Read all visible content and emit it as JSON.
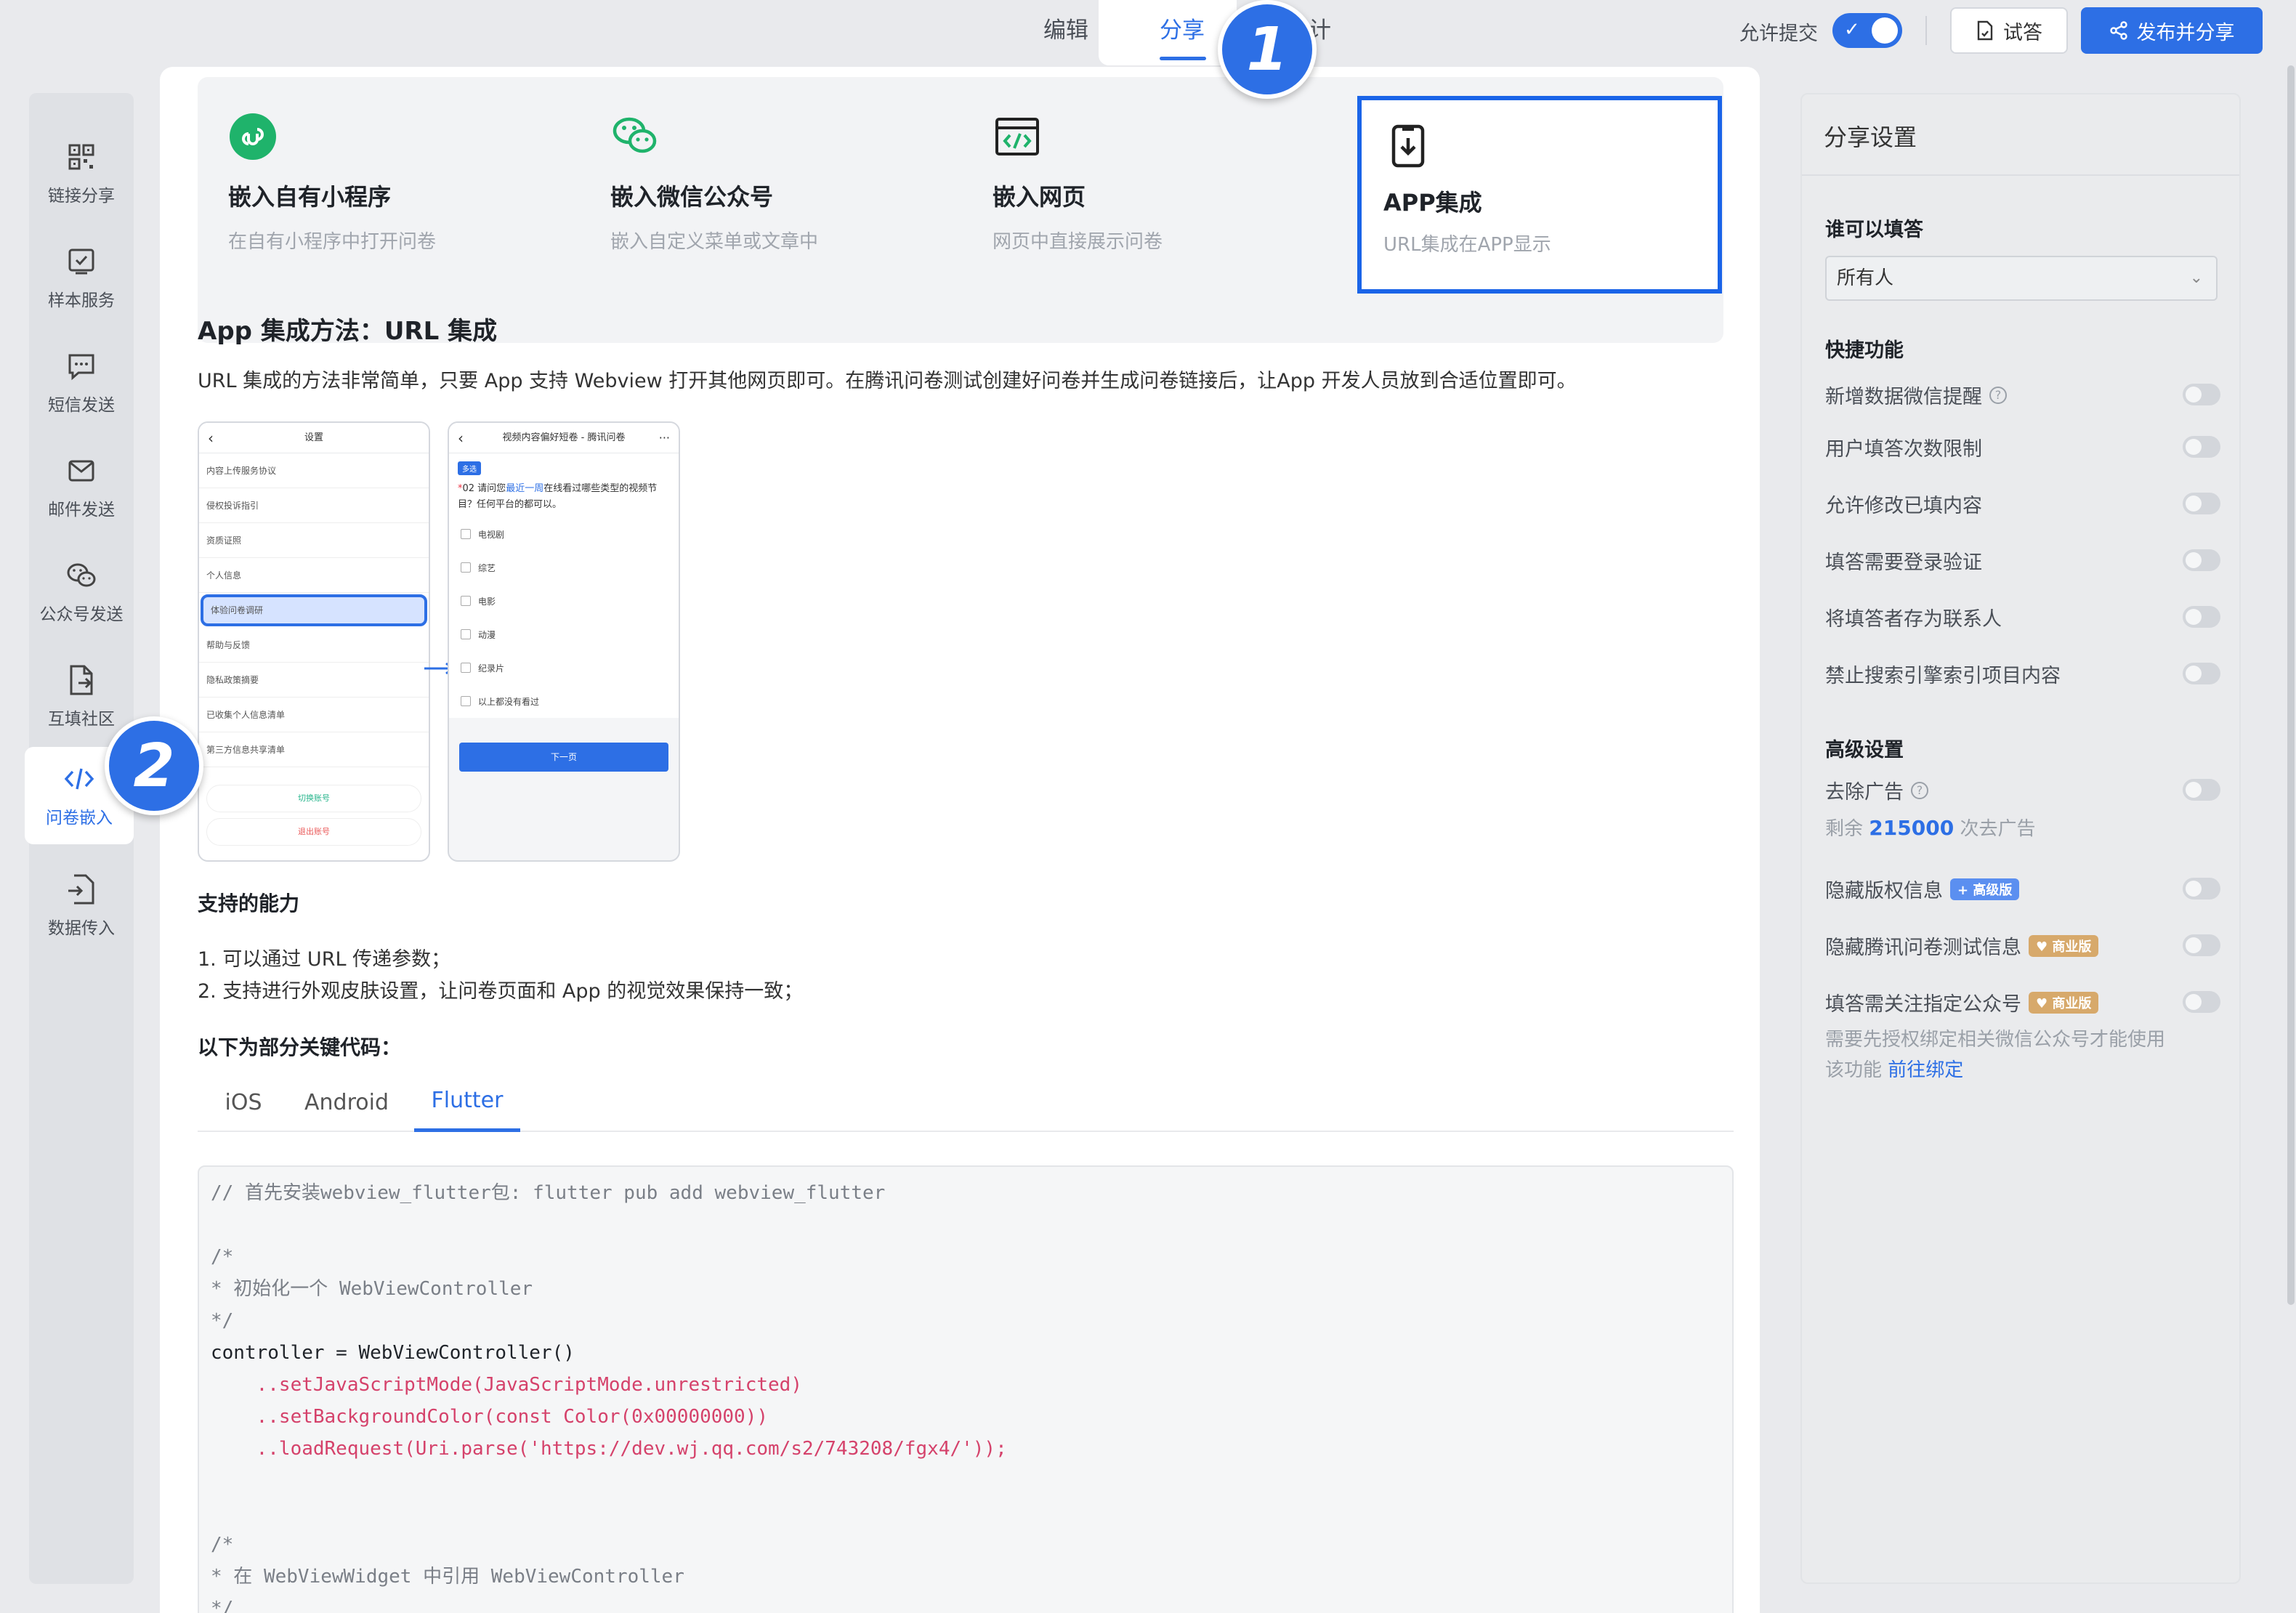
{
  "topbar": {
    "steps": [
      "编辑",
      "分享",
      "统计"
    ],
    "allow_label": "允许提交",
    "try_label": "试答",
    "publish_label": "发布并分享"
  },
  "badges": [
    "1",
    "2"
  ],
  "nav": [
    {
      "label": "链接分享",
      "icon": "qrcode-icon"
    },
    {
      "label": "样本服务",
      "icon": "checkbox-icon"
    },
    {
      "label": "短信发送",
      "icon": "message-icon"
    },
    {
      "label": "邮件发送",
      "icon": "mail-icon"
    },
    {
      "label": "公众号发送",
      "icon": "wechat-icon"
    },
    {
      "label": "互填社区",
      "icon": "document-icon"
    },
    {
      "label": "问卷嵌入",
      "icon": "code-icon"
    },
    {
      "label": "数据传入",
      "icon": "import-icon"
    }
  ],
  "cards": [
    {
      "title": "嵌入自有小程序",
      "desc": "在自有小程序中打开问卷",
      "icon": "miniprogram-icon"
    },
    {
      "title": "嵌入微信公众号",
      "desc": "嵌入自定义菜单或文章中",
      "icon": "wechat-icon"
    },
    {
      "title": "嵌入网页",
      "desc": "网页中直接展示问卷",
      "icon": "webpage-code-icon"
    },
    {
      "title": "APP集成",
      "desc": "URL集成在APP显示",
      "icon": "app-download-icon"
    }
  ],
  "main": {
    "section_title": "App 集成方法：URL 集成",
    "description": "URL 集成的方法非常简单，只要 App 支持 Webview 打开其他网页即可。在腾讯问卷测试创建好问卷并生成问卷链接后，让App 开发人员放到合适位置即可。",
    "capabilities_title": "支持的能力",
    "capabilities": [
      "1. 可以通过 URL 传递参数；",
      "2. 支持进行外观皮肤设置，让问卷页面和 App 的视觉效果保持一致；"
    ],
    "code_title": "以下为部分关键代码：",
    "tabs": [
      "iOS",
      "Android",
      "Flutter"
    ],
    "active_tab": "Flutter"
  },
  "mockup": {
    "settings_title": "设置",
    "settings_rows": [
      "内容上传服务协议",
      "侵权投诉指引",
      "资质证照",
      "个人信息",
      "体验问卷调研",
      "帮助与反馈",
      "隐私政策摘要",
      "已收集个人信息清单",
      "第三方信息共享清单"
    ],
    "switch_account": "切换账号",
    "logout": "退出账号",
    "survey_title": "视频内容偏好短卷 - 腾讯问卷",
    "survey_tag": "多选",
    "survey_q_prefix": "02 请问您",
    "survey_q_highlight": "最近一周",
    "survey_q_suffix": "在线看过哪些类型的视频节目？任何平台的都可以。",
    "survey_options": [
      "电视剧",
      "综艺",
      "电影",
      "动漫",
      "纪录片",
      "以上都没有看过"
    ],
    "next": "下一页"
  },
  "code_lines": [
    "// 首先安装webview_flutter包: flutter pub add webview_flutter",
    "",
    "/*",
    "* 初始化一个 WebViewController",
    "*/",
    "controller = WebViewController()",
    "    ..setJavaScriptMode(JavaScriptMode.unrestricted)",
    "    ..setBackgroundColor(const Color(0x00000000))",
    "    ..loadRequest(Uri.parse('https://dev.wj.qq.com/s2/743208/fgx4/'));",
    "",
    "",
    "/*",
    "* 在 WebViewWidget 中引用 WebViewController",
    "*/"
  ],
  "right": {
    "title": "分享设置",
    "who_title": "谁可以填答",
    "who_value": "所有人",
    "quick_title": "快捷功能",
    "quick_items": [
      "新增数据微信提醒",
      "用户填答次数限制",
      "允许修改已填内容",
      "填答需要登录验证",
      "将填答者存为联系人",
      "禁止搜索引擎索引项目内容"
    ],
    "advanced_title": "高级设置",
    "remove_ads": "去除广告",
    "remaining_prefix": "剩余",
    "remaining_count": "215000",
    "remaining_suffix": "次去广告",
    "hide_copyright": "隐藏版权信息",
    "badge_advanced": "+ 高级版",
    "hide_tencent": "隐藏腾讯问卷测试信息",
    "badge_business": "♥ 商业版",
    "follow_account": "填答需关注指定公众号",
    "follow_note_1": "需要先授权绑定相关微信公众号才能使用",
    "follow_note_2": "该功能",
    "bind_link": "前往绑定"
  },
  "colors": {
    "accent": "#2d6fe5",
    "selected_border": "#1a64e8",
    "nav_bg": "#dfe1e5"
  }
}
